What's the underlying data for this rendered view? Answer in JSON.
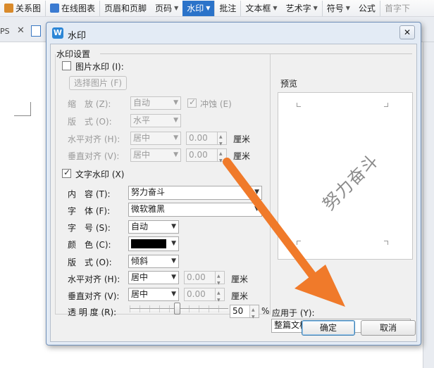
{
  "ribbon": {
    "items": [
      {
        "label": "关系图",
        "icon_color": "#d98a2b"
      },
      {
        "label": "在线图表",
        "icon_color": "#3b7bd1"
      },
      {
        "label": "页眉和页脚"
      },
      {
        "label": "页码"
      },
      {
        "label": "水印"
      },
      {
        "label": "批注"
      },
      {
        "label": "文本框"
      },
      {
        "label": "艺术字"
      },
      {
        "label": "符号"
      },
      {
        "label": "公式"
      },
      {
        "label": "首字下"
      }
    ]
  },
  "tabs": {
    "ps": "PS",
    "close": "✕"
  },
  "dialog": {
    "title": "水印",
    "app_icon": "W",
    "close": "✕",
    "group": "水印设置",
    "picture": {
      "checkbox": "图片水印 (I):",
      "select_button": "选择图片 (F)",
      "scale_label": "缩　放 (Z):",
      "scale_value": "自动",
      "washout": "冲蚀 (E)",
      "layout_label": "版　式 (O):",
      "layout_value": "水平",
      "halign_label": "水平对齐 (H):",
      "halign_value": "居中",
      "halign_offset": "0.00",
      "valign_label": "垂直对齐 (V):",
      "valign_value": "居中",
      "valign_offset": "0.00",
      "unit": "厘米"
    },
    "text": {
      "checkbox": "文字水印 (X)",
      "content_label": "内　容 (T):",
      "content_value": "努力奋斗",
      "font_label": "字　体 (F):",
      "font_value": "微软雅黑",
      "size_label": "字　号 (S):",
      "size_value": "自动",
      "color_label": "颜　色 (C):",
      "color_value": "#000000",
      "layout_label": "版　式 (O):",
      "layout_value": "倾斜",
      "halign_label": "水平对齐 (H):",
      "halign_value": "居中",
      "halign_offset": "0.00",
      "valign_label": "垂直对齐 (V):",
      "valign_value": "居中",
      "valign_offset": "0.00",
      "unit": "厘米",
      "transparency_label": "透 明 度 (R):",
      "transparency_value": "50",
      "percent": "%"
    },
    "preview_label": "预览",
    "preview_text": "努力奋斗",
    "apply_label": "应用于 (Y):",
    "apply_value": "整篇文档",
    "ok": "确定",
    "cancel": "取消"
  },
  "colors": {
    "accent": "#2b73c9",
    "annotation_arrow": "#f07a2a"
  }
}
